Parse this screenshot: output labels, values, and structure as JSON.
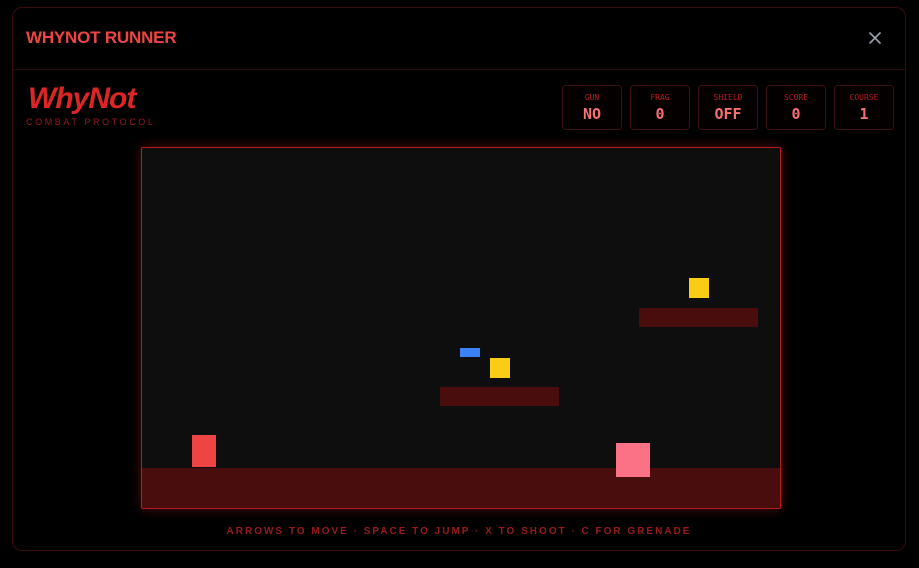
{
  "window": {
    "title": "WHYNOT RUNNER",
    "close_icon": "close-icon"
  },
  "brand": {
    "logo": "WhyNot",
    "tagline": "COMBAT PROTOCOL"
  },
  "stats": [
    {
      "label": "GUN",
      "value": "NO"
    },
    {
      "label": "FRAG",
      "value": "0"
    },
    {
      "label": "SHIELD",
      "value": "OFF"
    },
    {
      "label": "SCORE",
      "value": "0"
    },
    {
      "label": "COURSE",
      "value": "1"
    }
  ],
  "controls": "ARROWS TO MOVE · SPACE TO JUMP · X TO SHOOT · C FOR GRENADE",
  "colors": {
    "accent": "#ef4444",
    "player": "#ef4444",
    "enemy": "#fb7185",
    "coin": "#facc15",
    "powerup": "#3b82f6",
    "platform": "#4a0d0d",
    "canvas_bg": "#0e0e0e"
  }
}
